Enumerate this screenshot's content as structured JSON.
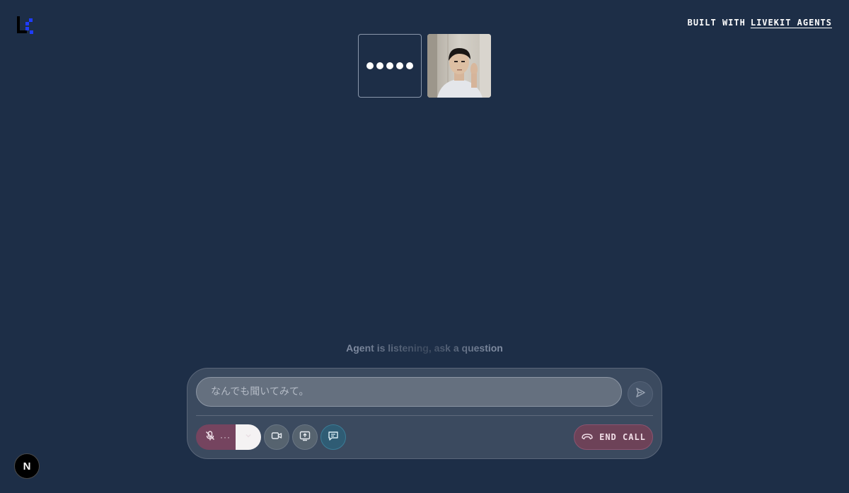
{
  "header": {
    "built_with": "BUILT WITH",
    "link_label": "LIVEKIT AGENTS"
  },
  "status": {
    "text": "Agent is listening, ask a question"
  },
  "chat": {
    "placeholder": "なんでも聞いてみて。",
    "value": ""
  },
  "controls": {
    "mic_state": "muted",
    "mic_more": "···",
    "end_call_label": "END CALL"
  },
  "badge": {
    "letter": "N"
  },
  "icons": {
    "logo": "livekit-logo",
    "agent": "agent-audio-visualizer",
    "send": "send-icon",
    "mic": "mic-off-icon",
    "device": "chevron-down-icon",
    "camera": "video-camera-icon",
    "share": "screen-share-icon",
    "chat": "chat-icon",
    "end": "phone-hangup-icon"
  },
  "colors": {
    "background": "#1d2e47",
    "accent_blue": "#1f3cff",
    "end_call": "#6d4258",
    "chat_active": "#2f5c74"
  }
}
